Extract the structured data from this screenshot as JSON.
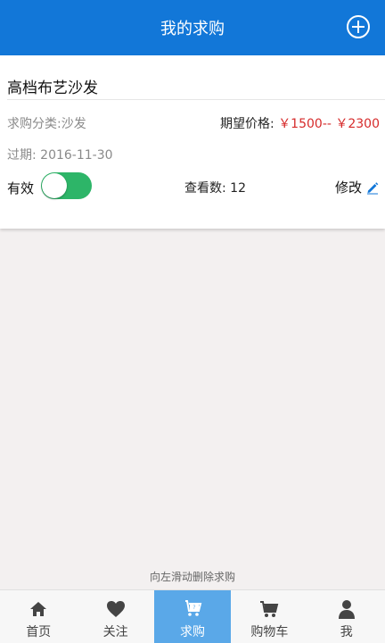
{
  "header": {
    "title": "我的求购",
    "add_icon": "plus-circle-icon"
  },
  "request": {
    "title": "高档布艺沙发",
    "category": "求购分类:沙发",
    "price_label": "期望价格:",
    "price_value": "￥1500-- ￥2300",
    "expire": "过期: 2016-11-30",
    "status_label": "有效",
    "status_on": true,
    "views": "查看数: 12",
    "edit_label": "修改",
    "edit_icon": "pencil-icon"
  },
  "hint": "向左滑动删除求购",
  "tabs": [
    {
      "label": "首页",
      "icon": "home-icon",
      "active": false
    },
    {
      "label": "关注",
      "icon": "heart-icon",
      "active": false
    },
    {
      "label": "求购",
      "icon": "shopping-bag-icon",
      "active": true
    },
    {
      "label": "购物车",
      "icon": "cart-icon",
      "active": false
    },
    {
      "label": "我",
      "icon": "user-icon",
      "active": false
    }
  ],
  "colors": {
    "primary": "#1277d8",
    "price": "#d62b2b",
    "toggle_on": "#2db568",
    "tab_active": "#5aa8e8"
  }
}
